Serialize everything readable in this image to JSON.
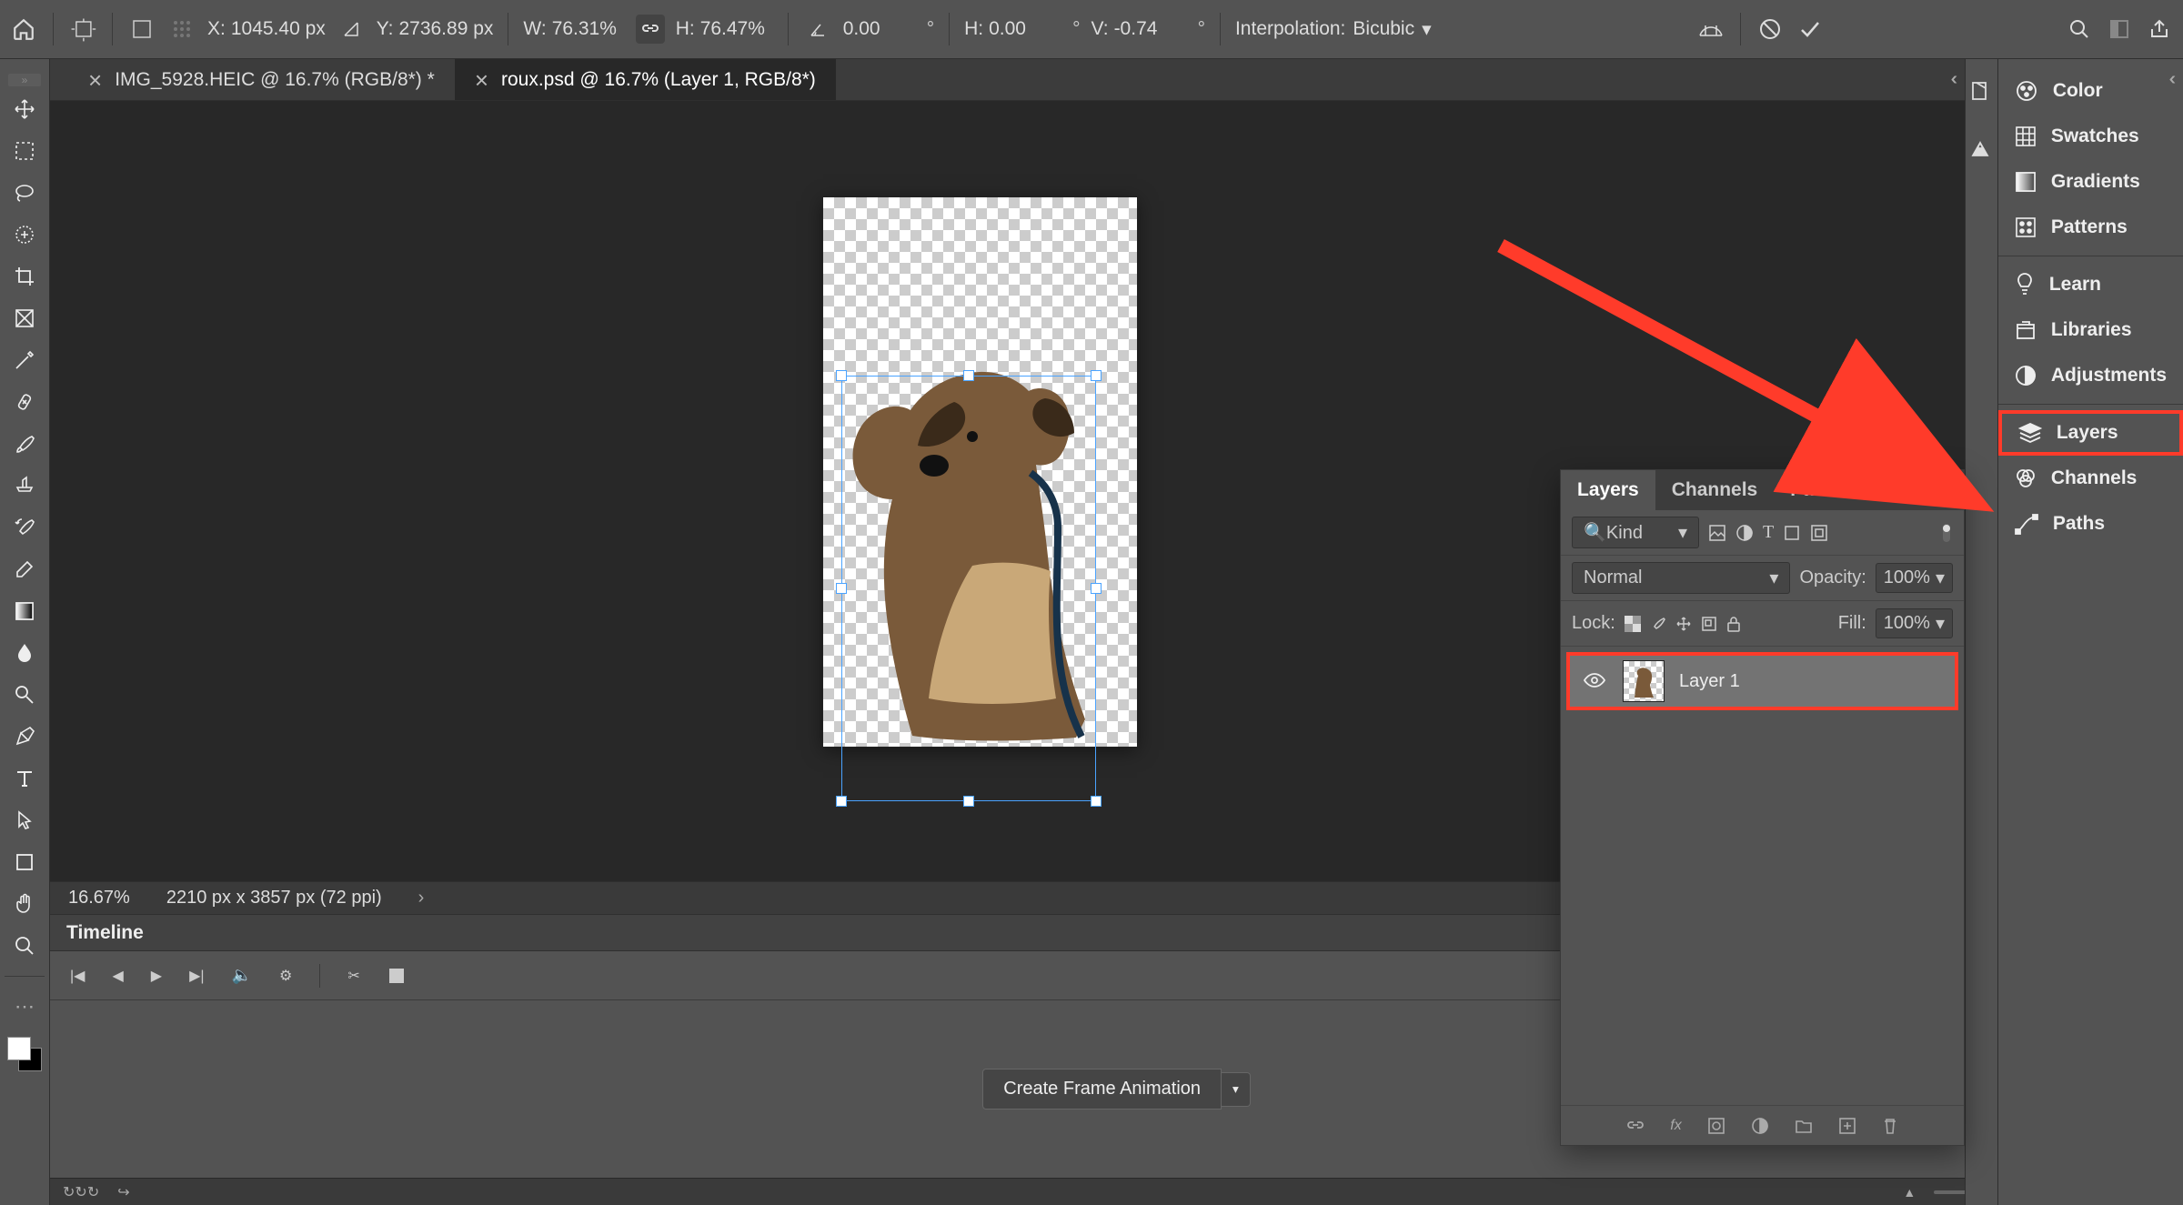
{
  "options_bar": {
    "x_label": "X:",
    "x_value": "1045.40 px",
    "y_label": "Y:",
    "y_value": "2736.89 px",
    "w_label": "W:",
    "w_value": "76.31%",
    "h_label": "H:",
    "h_value": "76.47%",
    "angle_value": "0.00",
    "skew_h_label": "H:",
    "skew_h_value": "0.00",
    "skew_v_label": "V:",
    "skew_v_value": "-0.74",
    "interp_label": "Interpolation:",
    "interp_value": "Bicubic"
  },
  "tabs": {
    "tab1": "IMG_5928.HEIC @ 16.7% (RGB/8*) *",
    "tab2": "roux.psd @ 16.7% (Layer 1, RGB/8*)"
  },
  "status": {
    "zoom": "16.67%",
    "doc_info": "2210 px x 3857 px (72 ppi)"
  },
  "timeline": {
    "title": "Timeline",
    "create_btn": "Create Frame Animation"
  },
  "layers_panel": {
    "tabs": {
      "layers": "Layers",
      "channels": "Channels",
      "paths": "Paths"
    },
    "filter_kind": "Kind",
    "blend_mode": "Normal",
    "opacity_label": "Opacity:",
    "opacity_value": "100%",
    "lock_label": "Lock:",
    "fill_label": "Fill:",
    "fill_value": "100%",
    "layer1_name": "Layer 1"
  },
  "right_panels": {
    "color": "Color",
    "swatches": "Swatches",
    "gradients": "Gradients",
    "patterns": "Patterns",
    "learn": "Learn",
    "libraries": "Libraries",
    "adjustments": "Adjustments",
    "layers": "Layers",
    "channels": "Channels",
    "paths": "Paths"
  },
  "deg_symbol": "°"
}
